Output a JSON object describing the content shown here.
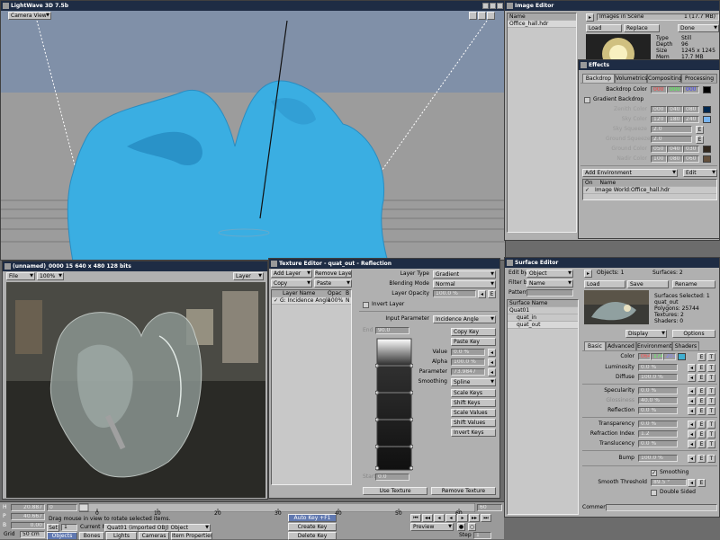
{
  "main": {
    "title": "LightWave 3D 7.5b",
    "view": "Camera View"
  },
  "image_editor": {
    "title": "Image Editor",
    "list_header": "Name",
    "list_item": "Office_hall.hdr",
    "images_in_scene": "Images in Scene",
    "count_info": "1 (17.7 MB)",
    "load": "Load",
    "replace": "Replace",
    "done": "Done",
    "type_label": "Type",
    "type_value": "Still",
    "depth_label": "Depth",
    "depth_value": "96",
    "size_label": "Size",
    "size_value": "1245 x 1245",
    "mem_label": "Mem",
    "mem_value": "17.7 MB"
  },
  "effects": {
    "title": "Effects",
    "tabs": [
      "Backdrop",
      "Volumetrics",
      "Compositing",
      "Processing"
    ],
    "backdrop_color_label": "Backdrop Color",
    "backdrop_color": [
      "000",
      "000",
      "000"
    ],
    "gradient_label": "Gradient Backdrop",
    "zenith_label": "Zenith Color",
    "zenith": [
      "000",
      "040",
      "080"
    ],
    "sky_label": "Sky Color",
    "sky": [
      "120",
      "180",
      "240"
    ],
    "sky_squeeze_label": "Sky Squeeze",
    "sky_squeeze": "2.0",
    "ground_squeeze_label": "Ground Squeeze",
    "ground_squeeze": "2.0",
    "ground_label": "Ground Color",
    "ground": [
      "050",
      "040",
      "030"
    ],
    "nadir_label": "Nadir Color",
    "nadir": [
      "100",
      "080",
      "060"
    ],
    "add_env": "Add Environment",
    "edit": "Edit",
    "col_on": "On",
    "col_name": "Name",
    "env_item": "Image World:Office_hall.hdr"
  },
  "render": {
    "title": "(unnamed)_0000  15  640 x 480 128 bits",
    "file": "File",
    "zoom": "100%",
    "layer": "Layer"
  },
  "texture": {
    "title": "Texture Editor - quat_out - Reflection",
    "add_layer": "Add Layer",
    "remove_layer": "Remove Layer",
    "copy": "Copy",
    "paste": "Paste",
    "col_name": "Layer Name",
    "col_opac": "Opac",
    "col_b": "B",
    "layer_item": "G: Incidence Angle",
    "layer_opac": "100%",
    "layer_b": "N",
    "layer_type_label": "Layer Type",
    "layer_type": "Gradient",
    "blending_label": "Blending Mode",
    "blending": "Normal",
    "opacity_label": "Layer Opacity",
    "opacity": "100.0 %",
    "invert_layer": "Invert Layer",
    "input_param_label": "Input Parameter",
    "input_param": "Incidence Angle",
    "end_label": "End",
    "end_value": "90.0",
    "start_label": "Start",
    "start_value": "0.0",
    "copy_key": "Copy Key",
    "paste_key": "Paste Key",
    "value_label": "Value",
    "value": "0.0 %",
    "alpha_label": "Alpha",
    "alpha": "100.0 %",
    "parameter_label": "Parameter",
    "parameter": "73.9847",
    "smoothing_label": "Smoothing",
    "smoothing": "Spline",
    "scale_keys": "Scale Keys",
    "shift_keys": "Shift Keys",
    "scale_values": "Scale Values",
    "shift_values": "Shift Values",
    "invert_keys": "Invert Keys",
    "use_texture": "Use Texture",
    "remove_texture": "Remove Texture"
  },
  "surface": {
    "title": "Surface Editor",
    "edit_by_label": "Edit by",
    "edit_by": "Object",
    "filter_by_label": "Filter by",
    "filter_by": "Name",
    "pattern_label": "Pattern",
    "list_header": "Surface Name",
    "items": [
      "Quat01",
      "quat_in",
      "quat_out"
    ],
    "objects": "Objects: 1",
    "surfaces": "Surfaces: 2",
    "load": "Load",
    "save": "Save",
    "rename": "Rename",
    "selected": "Surfaces Selected: 1",
    "sel_name": "quat_out",
    "polygons": "Polygons: 25744",
    "textures": "Textures: 2",
    "shaders": "Shaders: 0",
    "display": "Display",
    "options": "Options",
    "tabs": [
      "Basic",
      "Advanced",
      "Environment",
      "Shaders"
    ],
    "color_label": "Color",
    "color": [
      "064",
      "174",
      "207"
    ],
    "luminosity_label": "Luminosity",
    "luminosity": "0.0 %",
    "diffuse_label": "Diffuse",
    "diffuse": "100.0 %",
    "specularity_label": "Specularity",
    "specularity": "0.0 %",
    "glossiness_label": "Glossiness",
    "glossiness": "40.0 %",
    "reflection_label": "Reflection",
    "reflection": "0.0 %",
    "transparency_label": "Transparency",
    "transparency": "0.0 %",
    "refraction_label": "Refraction Index",
    "refraction": "1.2",
    "translucency_label": "Translucency",
    "translucency": "0.0 %",
    "bump_label": "Bump",
    "bump": "100.0 %",
    "smoothing": "Smoothing",
    "smooth_threshold_label": "Smooth Threshold",
    "smooth_threshold": "89.5 °",
    "double_sided": "Double Sided",
    "comment_label": "Comment"
  },
  "timeline": {
    "ticks": [
      "0",
      "10",
      "20",
      "30",
      "40",
      "50",
      "60"
    ],
    "h_label": "H",
    "h": "20.887",
    "p_label": "P",
    "p": "40.667",
    "b_label": "B",
    "b": "0.00",
    "frame": "0",
    "end_frame": "60",
    "grid_label": "Grid",
    "grid": "50 cm",
    "status": "Drag mouse in view to rotate selected items.",
    "set": "Set",
    "set_val": "1",
    "current_item_label": "Current Item",
    "current_item": "Quat01 (imported OBJ) Object",
    "objects": "Objects",
    "bones": "Bones",
    "lights": "Lights",
    "cameras": "Cameras",
    "item_props": "Item Properties",
    "auto_key": "Auto Key",
    "auto_key_val": "+F1",
    "create_key": "Create Key",
    "delete_key": "Delete Key",
    "preview": "Preview",
    "step_label": "Step",
    "step": "1"
  },
  "colors": {
    "title_bar": "#1e2c44",
    "blob": "#3aaee2",
    "sky": "#8090a8"
  }
}
